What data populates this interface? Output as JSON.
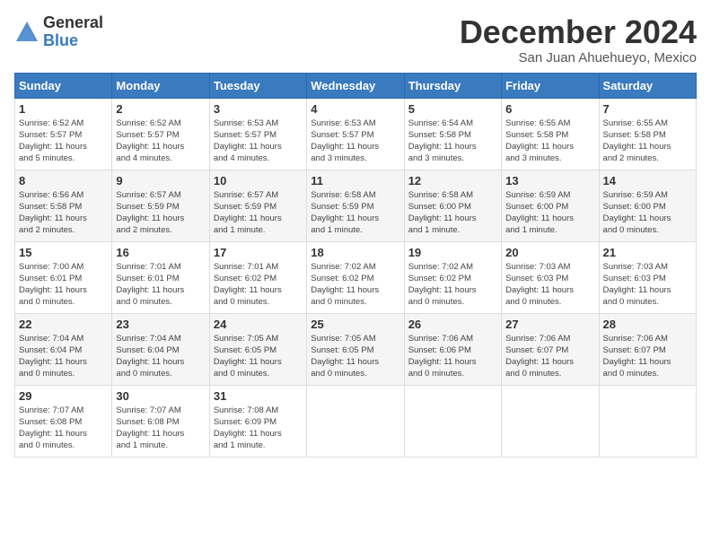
{
  "logo": {
    "general": "General",
    "blue": "Blue"
  },
  "title": "December 2024",
  "location": "San Juan Ahuehueyo, Mexico",
  "days_of_week": [
    "Sunday",
    "Monday",
    "Tuesday",
    "Wednesday",
    "Thursday",
    "Friday",
    "Saturday"
  ],
  "weeks": [
    [
      {
        "day": "1",
        "info": "Sunrise: 6:52 AM\nSunset: 5:57 PM\nDaylight: 11 hours\nand 5 minutes."
      },
      {
        "day": "2",
        "info": "Sunrise: 6:52 AM\nSunset: 5:57 PM\nDaylight: 11 hours\nand 4 minutes."
      },
      {
        "day": "3",
        "info": "Sunrise: 6:53 AM\nSunset: 5:57 PM\nDaylight: 11 hours\nand 4 minutes."
      },
      {
        "day": "4",
        "info": "Sunrise: 6:53 AM\nSunset: 5:57 PM\nDaylight: 11 hours\nand 3 minutes."
      },
      {
        "day": "5",
        "info": "Sunrise: 6:54 AM\nSunset: 5:58 PM\nDaylight: 11 hours\nand 3 minutes."
      },
      {
        "day": "6",
        "info": "Sunrise: 6:55 AM\nSunset: 5:58 PM\nDaylight: 11 hours\nand 3 minutes."
      },
      {
        "day": "7",
        "info": "Sunrise: 6:55 AM\nSunset: 5:58 PM\nDaylight: 11 hours\nand 2 minutes."
      }
    ],
    [
      {
        "day": "8",
        "info": "Sunrise: 6:56 AM\nSunset: 5:58 PM\nDaylight: 11 hours\nand 2 minutes."
      },
      {
        "day": "9",
        "info": "Sunrise: 6:57 AM\nSunset: 5:59 PM\nDaylight: 11 hours\nand 2 minutes."
      },
      {
        "day": "10",
        "info": "Sunrise: 6:57 AM\nSunset: 5:59 PM\nDaylight: 11 hours\nand 1 minute."
      },
      {
        "day": "11",
        "info": "Sunrise: 6:58 AM\nSunset: 5:59 PM\nDaylight: 11 hours\nand 1 minute."
      },
      {
        "day": "12",
        "info": "Sunrise: 6:58 AM\nSunset: 6:00 PM\nDaylight: 11 hours\nand 1 minute."
      },
      {
        "day": "13",
        "info": "Sunrise: 6:59 AM\nSunset: 6:00 PM\nDaylight: 11 hours\nand 1 minute."
      },
      {
        "day": "14",
        "info": "Sunrise: 6:59 AM\nSunset: 6:00 PM\nDaylight: 11 hours\nand 0 minutes."
      }
    ],
    [
      {
        "day": "15",
        "info": "Sunrise: 7:00 AM\nSunset: 6:01 PM\nDaylight: 11 hours\nand 0 minutes."
      },
      {
        "day": "16",
        "info": "Sunrise: 7:01 AM\nSunset: 6:01 PM\nDaylight: 11 hours\nand 0 minutes."
      },
      {
        "day": "17",
        "info": "Sunrise: 7:01 AM\nSunset: 6:02 PM\nDaylight: 11 hours\nand 0 minutes."
      },
      {
        "day": "18",
        "info": "Sunrise: 7:02 AM\nSunset: 6:02 PM\nDaylight: 11 hours\nand 0 minutes."
      },
      {
        "day": "19",
        "info": "Sunrise: 7:02 AM\nSunset: 6:02 PM\nDaylight: 11 hours\nand 0 minutes."
      },
      {
        "day": "20",
        "info": "Sunrise: 7:03 AM\nSunset: 6:03 PM\nDaylight: 11 hours\nand 0 minutes."
      },
      {
        "day": "21",
        "info": "Sunrise: 7:03 AM\nSunset: 6:03 PM\nDaylight: 11 hours\nand 0 minutes."
      }
    ],
    [
      {
        "day": "22",
        "info": "Sunrise: 7:04 AM\nSunset: 6:04 PM\nDaylight: 11 hours\nand 0 minutes."
      },
      {
        "day": "23",
        "info": "Sunrise: 7:04 AM\nSunset: 6:04 PM\nDaylight: 11 hours\nand 0 minutes."
      },
      {
        "day": "24",
        "info": "Sunrise: 7:05 AM\nSunset: 6:05 PM\nDaylight: 11 hours\nand 0 minutes."
      },
      {
        "day": "25",
        "info": "Sunrise: 7:05 AM\nSunset: 6:05 PM\nDaylight: 11 hours\nand 0 minutes."
      },
      {
        "day": "26",
        "info": "Sunrise: 7:06 AM\nSunset: 6:06 PM\nDaylight: 11 hours\nand 0 minutes."
      },
      {
        "day": "27",
        "info": "Sunrise: 7:06 AM\nSunset: 6:07 PM\nDaylight: 11 hours\nand 0 minutes."
      },
      {
        "day": "28",
        "info": "Sunrise: 7:06 AM\nSunset: 6:07 PM\nDaylight: 11 hours\nand 0 minutes."
      }
    ],
    [
      {
        "day": "29",
        "info": "Sunrise: 7:07 AM\nSunset: 6:08 PM\nDaylight: 11 hours\nand 0 minutes."
      },
      {
        "day": "30",
        "info": "Sunrise: 7:07 AM\nSunset: 6:08 PM\nDaylight: 11 hours\nand 1 minute."
      },
      {
        "day": "31",
        "info": "Sunrise: 7:08 AM\nSunset: 6:09 PM\nDaylight: 11 hours\nand 1 minute."
      },
      {
        "day": "",
        "info": ""
      },
      {
        "day": "",
        "info": ""
      },
      {
        "day": "",
        "info": ""
      },
      {
        "day": "",
        "info": ""
      }
    ]
  ]
}
